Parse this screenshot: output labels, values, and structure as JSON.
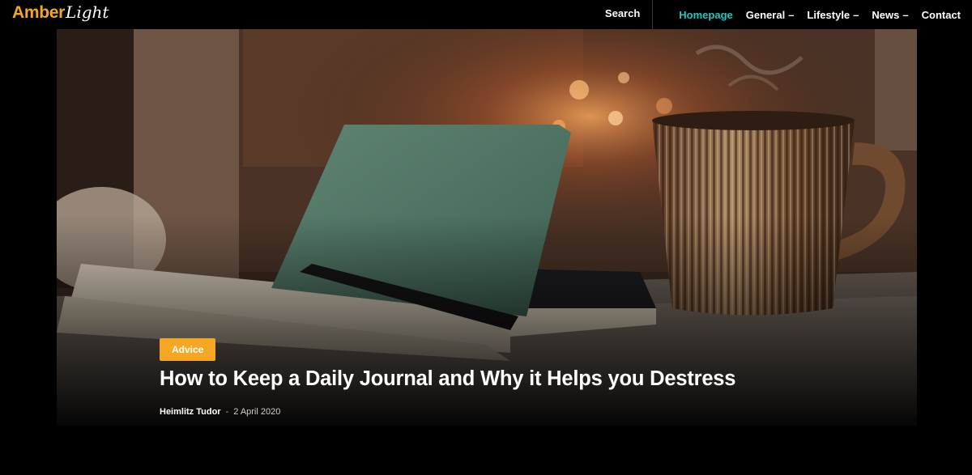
{
  "site": {
    "logo_primary": "Amber",
    "logo_secondary": "Light",
    "brand_color": "#f5a623",
    "active_color": "#1fc7c0"
  },
  "nav": {
    "search_label": "Search",
    "items": [
      {
        "label": "Homepage",
        "active": true,
        "dropdown": false
      },
      {
        "label": "General",
        "active": false,
        "dropdown": true
      },
      {
        "label": "Lifestyle",
        "active": false,
        "dropdown": true
      },
      {
        "label": "News",
        "active": false,
        "dropdown": true
      },
      {
        "label": "Contact",
        "active": false,
        "dropdown": false
      }
    ],
    "dropdown_glyph": "–"
  },
  "hero": {
    "category": "Advice",
    "title": "How to Keep a Daily Journal and Why it Helps you Destress",
    "author": "Heimlitz Tudor",
    "separator": "-",
    "date": "2 April 2020"
  }
}
